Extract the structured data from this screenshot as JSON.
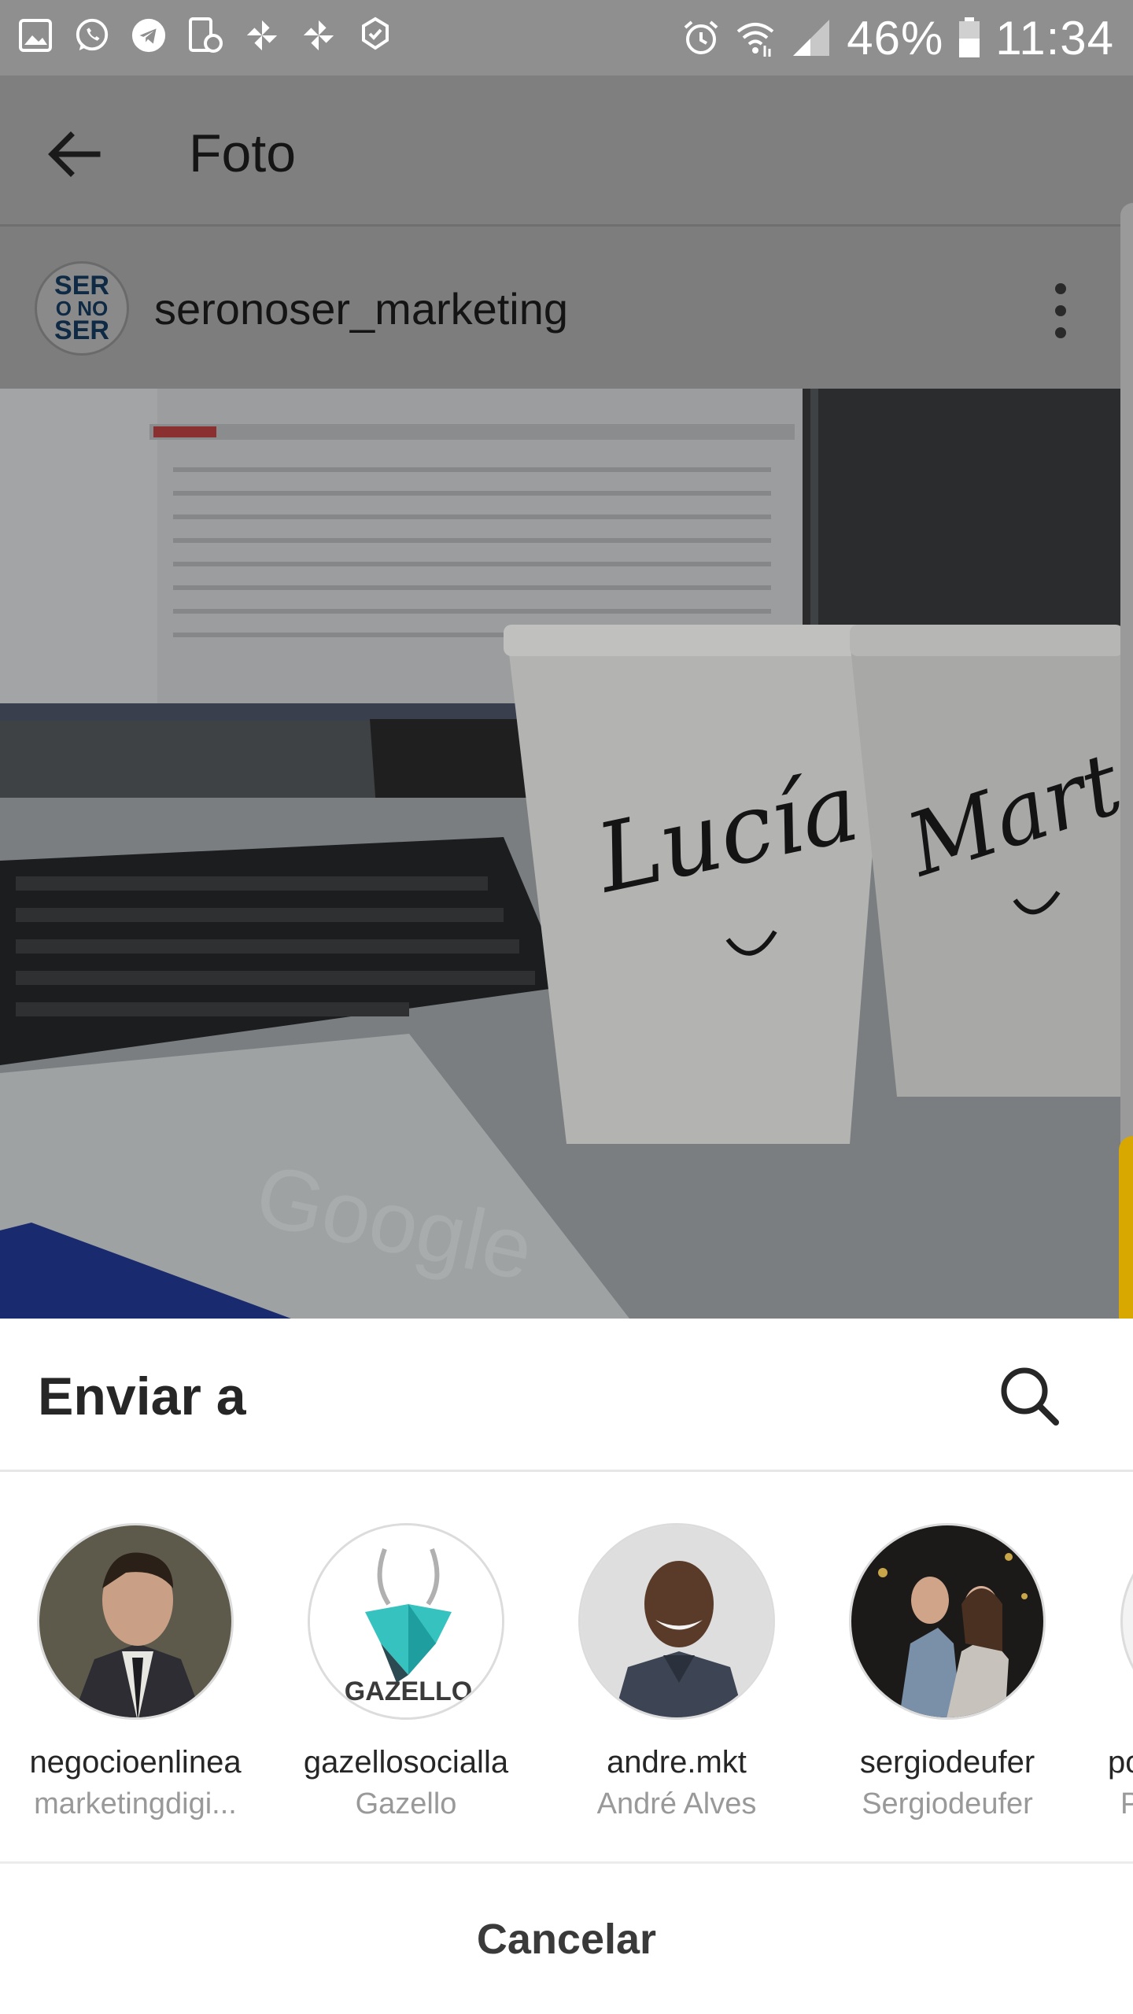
{
  "status_bar": {
    "battery": "46%",
    "time": "11:34",
    "left_icons": [
      "gallery-icon",
      "whatsapp-icon",
      "telegram-icon",
      "device-icon",
      "pinwheel-icon",
      "pinwheel-icon",
      "badge-icon"
    ],
    "right_icons": [
      "alarm-icon",
      "wifi-icon",
      "signal-icon",
      "battery-icon"
    ]
  },
  "header": {
    "title": "Foto"
  },
  "post": {
    "username": "seronoser_marketing",
    "avatar_text": [
      "SER",
      "O NO",
      "SER"
    ],
    "photo_handwriting": [
      "Lucía",
      "Marta"
    ],
    "photo_watermark": "Google"
  },
  "share_sheet": {
    "title": "Enviar a",
    "contacts": [
      {
        "username": "negocioenlinea",
        "subtitle": "marketingdigi..."
      },
      {
        "username": "gazellosocialla",
        "subtitle": "Gazello",
        "avatar_text": "GAZELLO"
      },
      {
        "username": "andre.mkt",
        "subtitle": "André Alves"
      },
      {
        "username": "sergiodeufer",
        "subtitle": "Sergiodeufer"
      },
      {
        "username": "po",
        "subtitle": "P"
      }
    ],
    "cancel_label": "Cancelar"
  },
  "colors": {
    "dim_overlay": "#7d7d7d",
    "accent_yellow": "#d9a800",
    "title_text": "#262626",
    "secondary_text": "#999999"
  }
}
